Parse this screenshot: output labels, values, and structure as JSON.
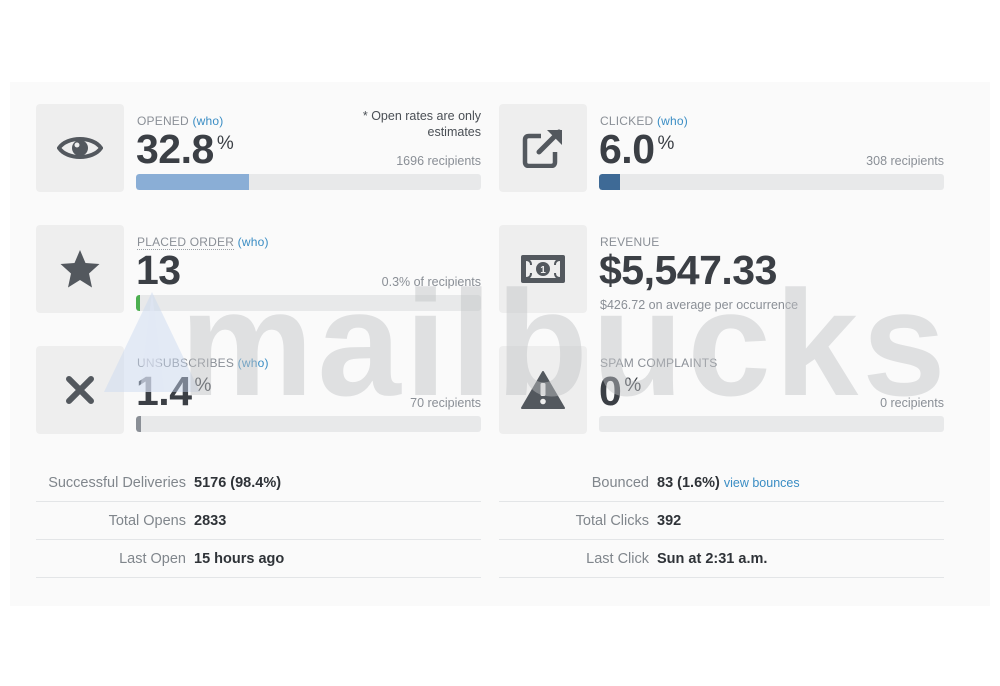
{
  "opened": {
    "label": "OPENED",
    "who": "(who)",
    "value": "32.8",
    "unit": "%",
    "recipients": "1696 recipients",
    "note_line1": "* Open rates are only",
    "note_line2": "estimates",
    "progress": 0.328,
    "bar_color": "#8aaed6",
    "icon": "eye-icon"
  },
  "clicked": {
    "label": "CLICKED",
    "who": "(who)",
    "value": "6.0",
    "unit": "%",
    "recipients": "308 recipients",
    "progress": 0.06,
    "bar_color": "#3e6a96",
    "icon": "external-link-icon"
  },
  "placed_order": {
    "label": "PLACED ORDER",
    "who": "(who)",
    "value": "13",
    "recipients": "0.3% of recipients",
    "progress": 0.003,
    "bar_color": "#4caf50",
    "icon": "star-icon"
  },
  "revenue": {
    "label": "REVENUE",
    "value": "$5,547.33",
    "subnote": "$426.72 on average per occurrence",
    "icon": "banknote-icon"
  },
  "unsubscribes": {
    "label": "UNSUBSCRIBES",
    "who": "(who)",
    "value": "1.4",
    "unit": "%",
    "recipients": "70 recipients",
    "progress": 0.014,
    "bar_color": "#8a8f96",
    "icon": "x-icon"
  },
  "spam": {
    "label": "SPAM COMPLAINTS",
    "value": "0",
    "unit": "%",
    "recipients": "0 recipients",
    "progress": 0,
    "icon": "warning-icon"
  },
  "stats_left": [
    {
      "key": "Successful Deliveries",
      "value": "5176 (98.4%)"
    },
    {
      "key": "Total Opens",
      "value": "2833"
    },
    {
      "key": "Last Open",
      "value": "15 hours ago"
    }
  ],
  "stats_right": [
    {
      "key": "Bounced",
      "value": "83 (1.6%)",
      "link": "view bounces"
    },
    {
      "key": "Total Clicks",
      "value": "392"
    },
    {
      "key": "Last Click",
      "value": "Sun at 2:31 a.m."
    }
  ],
  "watermark": "mailbucks",
  "icon_color": "#53585e"
}
